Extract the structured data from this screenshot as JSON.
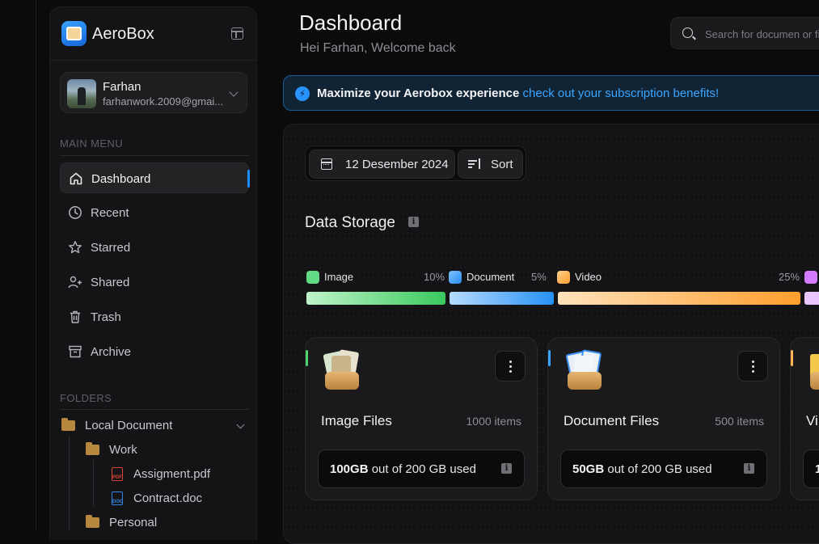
{
  "app": {
    "name": "AeroBox"
  },
  "user": {
    "name": "Farhan",
    "email": "farhanwork.2009@gmai..."
  },
  "sidebar": {
    "main_menu_title": "MAIN MENU",
    "items": [
      {
        "label": "Dashboard",
        "icon": "home-icon",
        "active": true
      },
      {
        "label": "Recent",
        "icon": "clock-icon"
      },
      {
        "label": "Starred",
        "icon": "star-icon"
      },
      {
        "label": "Shared",
        "icon": "users-icon"
      },
      {
        "label": "Trash",
        "icon": "trash-icon"
      },
      {
        "label": "Archive",
        "icon": "archive-icon"
      }
    ],
    "folders_title": "FOLDERS",
    "folders": {
      "root": "Local Document",
      "work": "Work",
      "file1": "Assigment.pdf",
      "file2": "Contract.doc",
      "personal": "Personal"
    },
    "file_badges": {
      "pdf": "PDF",
      "doc": "DOC"
    }
  },
  "header": {
    "title": "Dashboard",
    "subtitle": "Hei Farhan, Welcome back",
    "search_placeholder": "Search for documen or fil"
  },
  "banner": {
    "strong": "Maximize your Aerobox experience",
    "link": "check out your subscription benefits!"
  },
  "toolbar": {
    "date": "12 Desember 2024",
    "sort": "Sort"
  },
  "storage": {
    "title": "Data Storage",
    "info_glyph": "i",
    "legend": [
      {
        "label": "Image",
        "percent": "10%",
        "color": "#4fd56f"
      },
      {
        "label": "Document",
        "percent": "5%",
        "color": "#3aa2ff"
      },
      {
        "label": "Video",
        "percent": "25%",
        "color": "#ffb454"
      },
      {
        "label": "",
        "percent": "",
        "color": "#d47cff"
      }
    ]
  },
  "cards": [
    {
      "title": "Image Files",
      "count": "1000 items",
      "used": "100GB",
      "total_text": "out of 200 GB used",
      "accent": "#4fd56f"
    },
    {
      "title": "Document Files",
      "count": "500 items",
      "used": "50GB",
      "total_text": "out of 200 GB used",
      "accent": "#3aa2ff"
    },
    {
      "title": "Vi",
      "count": "",
      "used": "1",
      "total_text": "",
      "accent": "#ffb454"
    }
  ],
  "colors": {
    "accent": "#1e8bff",
    "link": "#3aa6ff",
    "banner_border": "#1a5d96"
  }
}
